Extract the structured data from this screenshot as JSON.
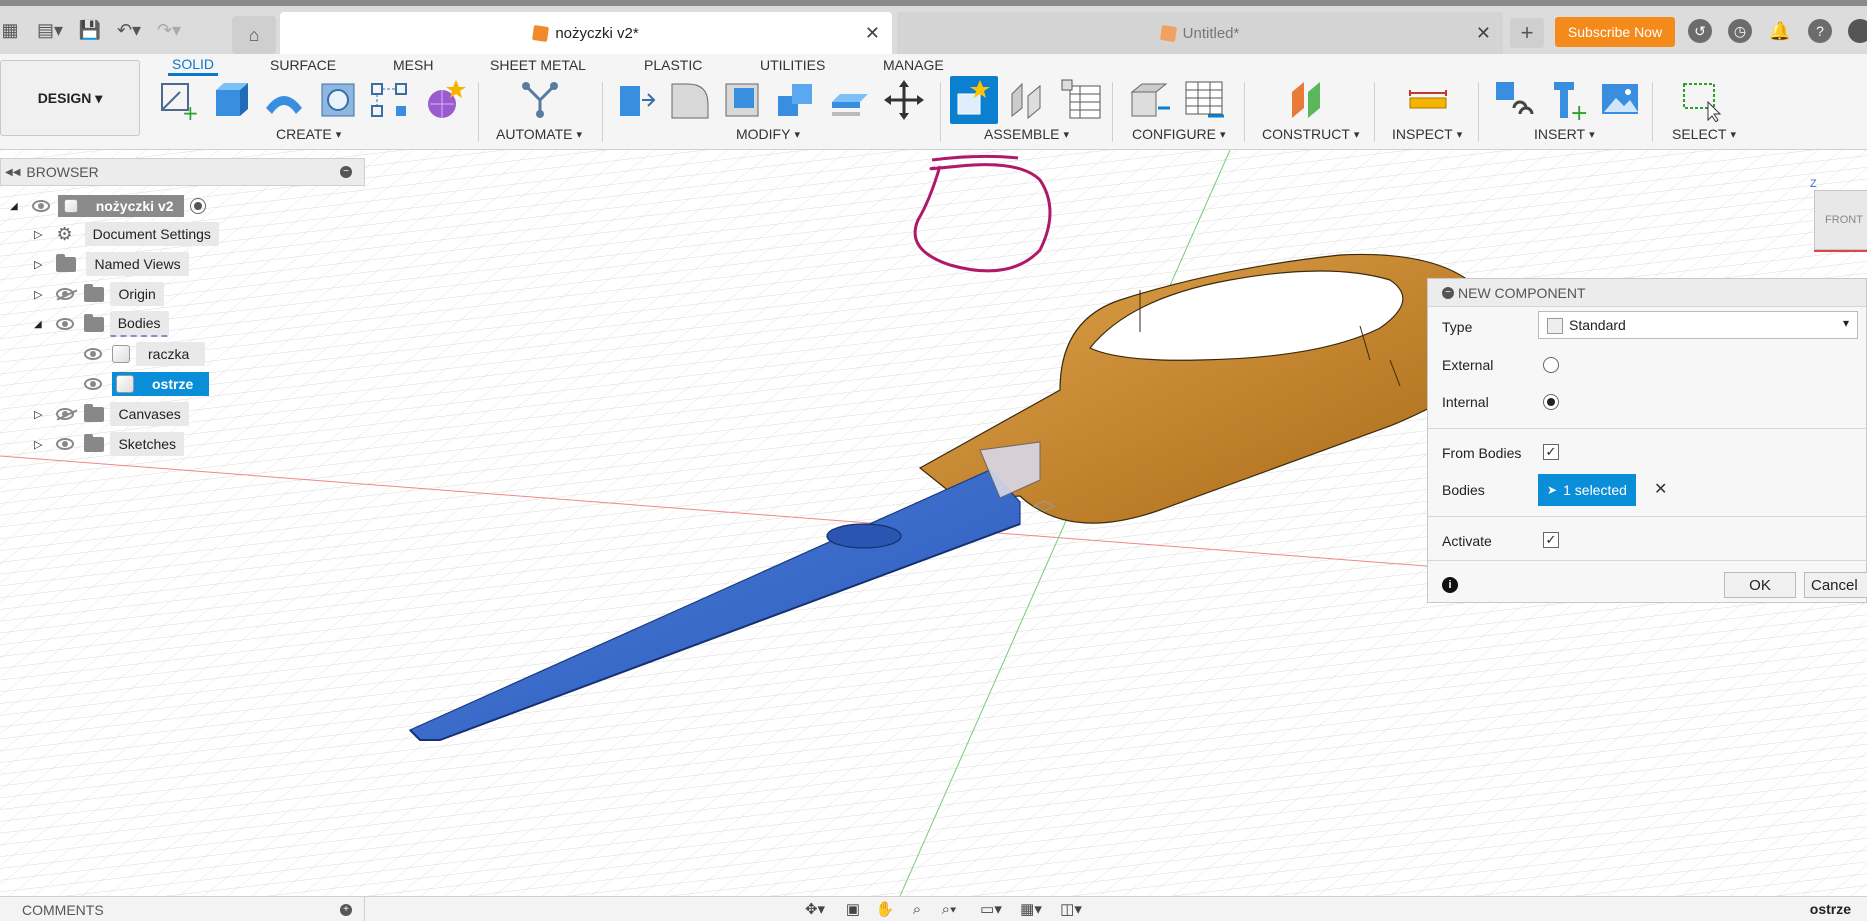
{
  "titlebar": {
    "active_tab": "nożyczki v2*",
    "inactive_tab": "Untitled*",
    "subscribe": "Subscribe Now"
  },
  "toolbar": {
    "design": "DESIGN",
    "workspace_tabs": [
      "SOLID",
      "SURFACE",
      "MESH",
      "SHEET METAL",
      "PLASTIC",
      "UTILITIES",
      "MANAGE"
    ],
    "active_tab": "SOLID",
    "groups": [
      "CREATE",
      "AUTOMATE",
      "MODIFY",
      "ASSEMBLE",
      "CONFIGURE",
      "CONSTRUCT",
      "INSPECT",
      "INSERT",
      "SELECT"
    ]
  },
  "browser": {
    "title": "BROWSER",
    "root": "nożyczki v2",
    "items": [
      {
        "label": "Document Settings"
      },
      {
        "label": "Named Views"
      },
      {
        "label": "Origin"
      },
      {
        "label": "Bodies"
      },
      {
        "label": "raczka"
      },
      {
        "label": "ostrze"
      },
      {
        "label": "Canvases"
      },
      {
        "label": "Sketches"
      }
    ]
  },
  "viewcube": {
    "face": "FRONT",
    "axis": "Z"
  },
  "dialog": {
    "title": "NEW COMPONENT",
    "type_label": "Type",
    "type_value": "Standard",
    "external_label": "External",
    "internal_label": "Internal",
    "from_bodies_label": "From Bodies",
    "bodies_label": "Bodies",
    "bodies_value": "1 selected",
    "activate_label": "Activate",
    "ok": "OK",
    "cancel": "Cancel"
  },
  "bottom": {
    "comments": "COMMENTS",
    "status": "ostrze"
  },
  "colors": {
    "accent": "#0a78c8",
    "subscribe": "#f48a1a",
    "blade": "#3c6fd0",
    "handle": "#c98a2e",
    "annotation": "#b0186a"
  }
}
